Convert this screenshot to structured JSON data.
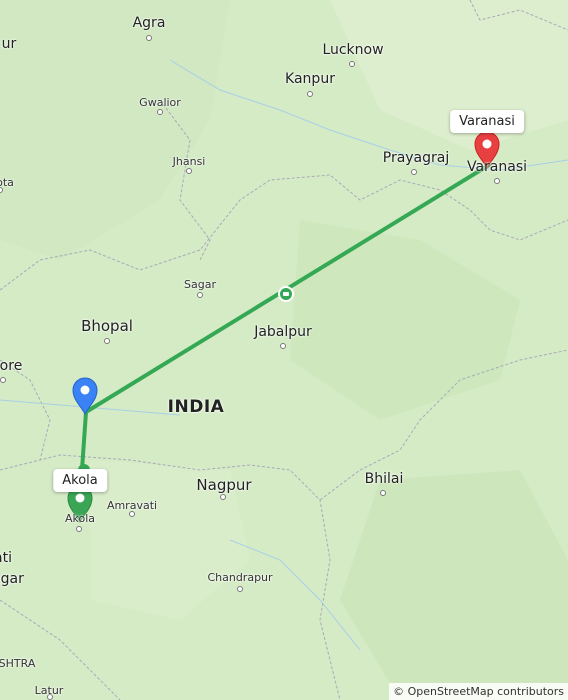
{
  "map": {
    "country_label": "INDIA",
    "cities": [
      {
        "name": "Agra",
        "size": "med"
      },
      {
        "name": "Lucknow",
        "size": "med"
      },
      {
        "name": "Kanpur",
        "size": "med"
      },
      {
        "name": "Gwalior",
        "size": "small"
      },
      {
        "name": "Jhansi",
        "size": "small"
      },
      {
        "name": "Prayagraj",
        "size": "med"
      },
      {
        "name": "Varanasi",
        "size": "med"
      },
      {
        "name": "Sagar",
        "size": "small"
      },
      {
        "name": "Bhopal",
        "size": "med"
      },
      {
        "name": "Jabalpur",
        "size": "med"
      },
      {
        "name": "Nagpur",
        "size": "med"
      },
      {
        "name": "Amravati",
        "size": "small"
      },
      {
        "name": "Akola",
        "size": "small"
      },
      {
        "name": "Bhilai",
        "size": "med"
      },
      {
        "name": "Chandrapur",
        "size": "small"
      },
      {
        "name": "Latur",
        "size": "small"
      }
    ],
    "edge_labels": [
      "ur",
      "ore",
      "ota",
      "ati",
      "agar",
      "SHTRA"
    ],
    "markers": {
      "start_label": "Akola",
      "end_label": "Varanasi",
      "start_color": "#3aa655",
      "end_color": "#e84040",
      "waypoint_color": "#3b82f6",
      "route_color": "#34a853"
    },
    "attribution": "© OpenStreetMap contributors"
  }
}
